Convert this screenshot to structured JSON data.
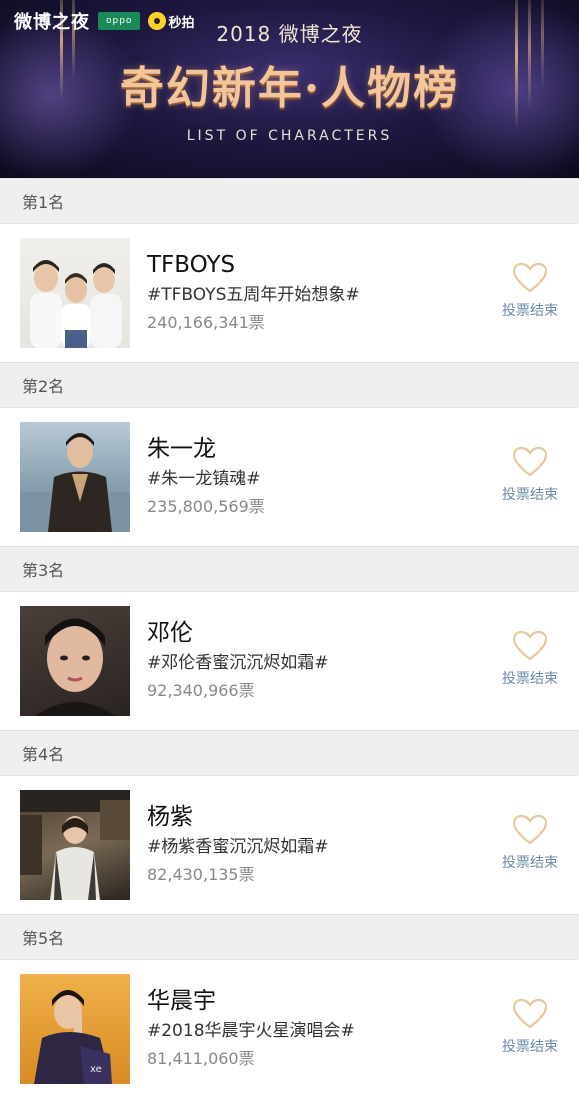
{
  "banner": {
    "logo_weibo": "微博之夜",
    "logo_oppo": "oppo",
    "logo_miaopai": "秒拍",
    "top_text": "2018 微博之夜",
    "title": "奇幻新年·人物榜",
    "subtitle": "LIST OF CHARACTERS"
  },
  "entries": [
    {
      "rank": "第1名",
      "name": "TFBOYS",
      "tag": "#TFBOYS五周年开始想象#",
      "votes": "240,166,341票",
      "vote_label": "投票结束"
    },
    {
      "rank": "第2名",
      "name": "朱一龙",
      "tag": "#朱一龙镇魂#",
      "votes": "235,800,569票",
      "vote_label": "投票结束"
    },
    {
      "rank": "第3名",
      "name": "邓伦",
      "tag": "#邓伦香蜜沉沉烬如霜#",
      "votes": "92,340,966票",
      "vote_label": "投票结束"
    },
    {
      "rank": "第4名",
      "name": "杨紫",
      "tag": "#杨紫香蜜沉沉烬如霜#",
      "votes": "82,430,135票",
      "vote_label": "投票结束"
    },
    {
      "rank": "第5名",
      "name": "华晨宇",
      "tag": "#2018华晨宇火星演唱会#",
      "votes": "81,411,060票",
      "vote_label": "投票结束"
    }
  ],
  "colors": {
    "heart": "#e8c79b",
    "vote_label": "#6d8aa8",
    "rank_bg": "#efefef"
  }
}
